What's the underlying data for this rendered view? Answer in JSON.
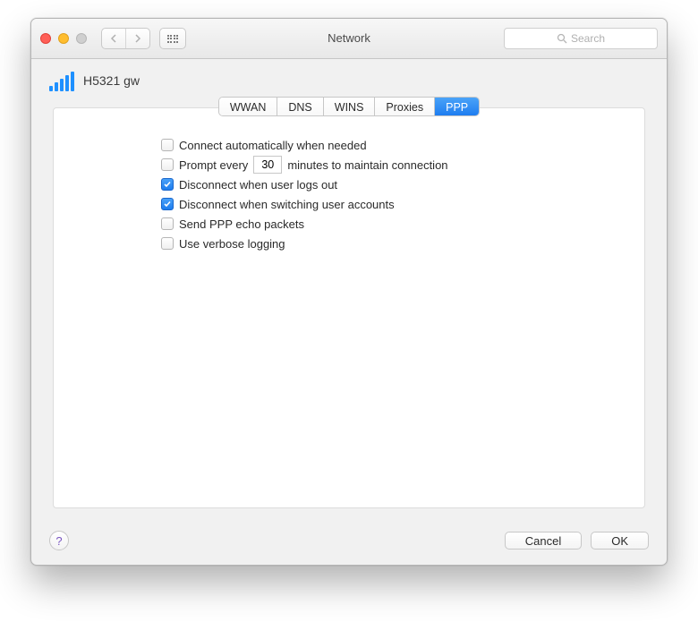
{
  "window": {
    "title": "Network",
    "search_placeholder": "Search"
  },
  "device": {
    "name": "H5321 gw"
  },
  "tabs": {
    "items": [
      "WWAN",
      "DNS",
      "WINS",
      "Proxies",
      "PPP"
    ],
    "active_index": 4
  },
  "options": {
    "connect_auto": {
      "label": "Connect automatically when needed",
      "checked": false
    },
    "prompt_every": {
      "prefix": "Prompt every",
      "value": "30",
      "suffix": "minutes to maintain connection",
      "checked": false
    },
    "disconnect_logout": {
      "label": "Disconnect when user logs out",
      "checked": true
    },
    "disconnect_switch": {
      "label": "Disconnect when switching user accounts",
      "checked": true
    },
    "send_echo": {
      "label": "Send PPP echo packets",
      "checked": false
    },
    "verbose": {
      "label": "Use verbose logging",
      "checked": false
    }
  },
  "footer": {
    "help": "?",
    "cancel": "Cancel",
    "ok": "OK"
  }
}
